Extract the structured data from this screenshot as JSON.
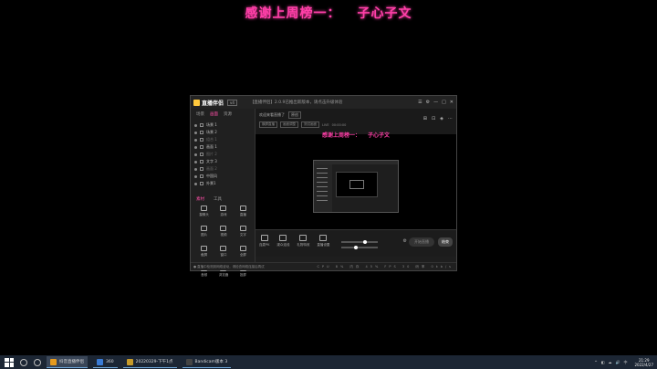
{
  "banner": {
    "prefix": "感谢上周榜一：",
    "name": "子心子文"
  },
  "app": {
    "title": "直播伴侣",
    "version": "v4",
    "notice": "【直播伴侣】2.0.9已推出新版本，请点击升级体验",
    "window_buttons": [
      "☰",
      "⚙",
      "—",
      "□",
      "✕"
    ],
    "left_tabs": [
      "场景",
      "画面",
      "资源"
    ],
    "scenes": [
      "场景 1",
      "场景 2",
      "组合 1",
      "画面 1",
      "图片 2",
      "文字 3",
      "画面 2",
      "中国风",
      "外景1"
    ],
    "tool_tabs": [
      "素材",
      "工具"
    ],
    "tools": [
      "摄像头",
      "游戏",
      "直播",
      "图片",
      "视频",
      "文字",
      "截屏",
      "窗口",
      "全屏",
      "音频",
      "浏览器",
      "投屏"
    ],
    "preview": {
      "title": "欢迎来看直播了",
      "tag": "原创",
      "row2": [
        "横屏直播",
        "画面调整",
        "测试画面",
        "LIVE",
        "00:00:00"
      ],
      "icons": [
        "⊞",
        "⊡",
        "◈",
        "⋯"
      ]
    },
    "inner_banner": {
      "prefix": "感谢上周榜一：",
      "name": "子心子文"
    },
    "bottom_tools": [
      "连麦PK",
      "观众连线",
      "礼物特效",
      "直播设置"
    ],
    "go_live": "开始直播",
    "end": "结束",
    "status": {
      "warning": "● 直播中检测到网络波动，请检查网络连接后再试",
      "stats": "CPU 8%   内存 45%   FPS 30   码率 0kb/s"
    }
  },
  "taskbar": {
    "apps": [
      {
        "label": "抖音直播伴侣",
        "color": "#e69b1f",
        "active": true
      },
      {
        "label": "360",
        "color": "#3a7bd5",
        "active": false
      },
      {
        "label": "20220329-下午1点",
        "color": "#c79b2a",
        "active": false
      },
      {
        "label": "Bandicam版本 3",
        "color": "#444444",
        "active": false
      }
    ],
    "tray": [
      "^",
      "◧",
      "☁",
      "🔊",
      "中"
    ],
    "time": "21:29",
    "date": "2022/4/27"
  }
}
